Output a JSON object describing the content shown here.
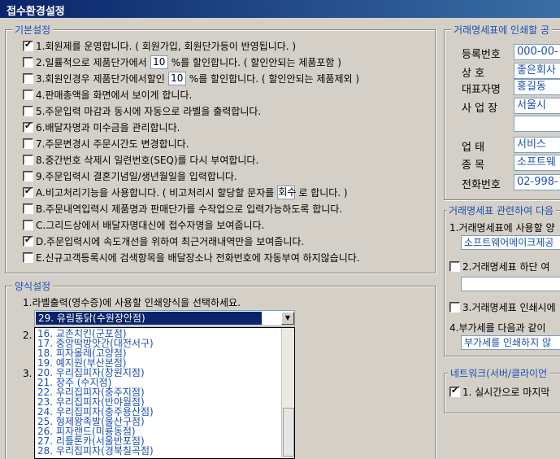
{
  "window": {
    "title": "접수환경설정"
  },
  "basic": {
    "legend": "기본설정",
    "items": [
      {
        "checked": true,
        "text": "1.회원제를 운영합니다. ( 회원가입, 회원단가등이 반영됩니다. )"
      },
      {
        "checked": false,
        "text_a": "2.일률적으로 제품단가에서",
        "value": "10",
        "text_b": "%를 할인합니다. ( 할인안되는 제품포함 )"
      },
      {
        "checked": false,
        "text_a": "3.회원인경우 제품단가에서할인",
        "value": "10",
        "text_b": "%를 할인합니다. ( 할인안되는 제품제외 )"
      },
      {
        "checked": false,
        "text": "4.판매총액을 화면에서 보이게 합니다."
      },
      {
        "checked": false,
        "text": "5.주문입력 마감과 동시에 자동으로 라벨을 출력합니다."
      },
      {
        "checked": true,
        "text": "6.배달자명과 미수금을 관리합니다."
      },
      {
        "checked": false,
        "text": "7.주문변경시 주문시간도 변경합니다."
      },
      {
        "checked": false,
        "text": "8.중간번호 삭제시 일련번호(SEQ)를 다시 부여합니다."
      },
      {
        "checked": false,
        "text": "9.주문입력시 결혼기념일/생년월일을 입력합니다."
      },
      {
        "checked": true,
        "text_a": "A.비고처리기능을 사용합니다.  ( 비고처리시 할당할 문자를",
        "value": "회수",
        "text_b": "로 합니다. )"
      },
      {
        "checked": false,
        "text": "B.주문내역입력시 제품명과 판매단가를 수작업으로 입력가능하도록 합니다."
      },
      {
        "checked": false,
        "text": "C.그리드상에서 배달자명대신에 접수자명을 보여줍니다."
      },
      {
        "checked": true,
        "text": "D.주문입력시에 속도개선을 위하여 최근거래내역만을 보여줍니다."
      },
      {
        "checked": false,
        "text": "E.신규고객등록시에 검색항목을 배달장소나 전화번호에 자동부여 하지않습니다."
      }
    ]
  },
  "print_style": {
    "legend": "양식설정",
    "prompt": "1.라벨출력(영수증)에 사용할 인쇄양식을 선택하세요.",
    "selected": "29. 유림통닭(수원장안점)",
    "label_2": "2.",
    "label_3": "3.",
    "options": [
      "16. 교촌치킨(군포점)",
      "17. 중앙떡방앗간(대전서구)",
      "18. 피자몰레(고양점)",
      "19. 예지원(부산본점)",
      "20. 우리집피자(창원지점)",
      "21. 창주 (수지점)",
      "22. 우리집피자(충주지점)",
      "23. 우리집피자(반야월점)",
      "24. 우리집피자(충주용산점)",
      "25. 형제왕족발(울산구점)",
      "26. 피자랜드(미룡동점)",
      "27. 리틀톤카(서울반포점)",
      "28. 우리집피자(경북칠곡점)"
    ]
  },
  "invoice": {
    "legend": "거래명세표에 인쇄할 공",
    "rows": [
      {
        "label": "등록번호",
        "value": "000-00-"
      },
      {
        "label": "상    호",
        "value": "좋은회사"
      },
      {
        "label": "대표자명",
        "value": "홍길동"
      },
      {
        "label": "사 업 장",
        "value": "서울시"
      },
      {
        "label": "",
        "value": ""
      },
      {
        "label": "업    태",
        "value": "서비스"
      },
      {
        "label": "종    목",
        "value": "소프트웨"
      },
      {
        "label": "전화번호",
        "value": "02-998-"
      }
    ]
  },
  "invoice_related": {
    "legend": "거래명세표 관련하여 다음",
    "item1": "1.거래명세표에 사용할 양",
    "item1_value": "소프트웨어메이크제공",
    "item2": "2.거래명세표 하단 여",
    "item3": "3.거래명세표 인쇄시에",
    "item4": "4.부가세를 다음과 같이",
    "item4_value": "부가세를 인쇄하지 않"
  },
  "network": {
    "legend": "네트워크(서버/클라이언",
    "item1": "1. 실시간으로 마지막"
  }
}
